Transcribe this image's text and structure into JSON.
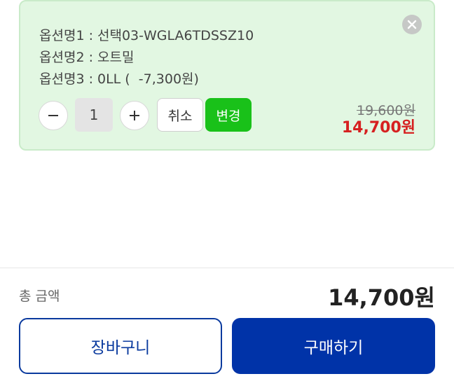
{
  "option_card": {
    "lines": [
      "옵션명1 : 선택03-WGLA6TDSSZ10",
      "옵션명2 : 오트밀",
      "옵션명3 : 0LL (  -7,300원)"
    ],
    "quantity": "1",
    "cancel_label": "취소",
    "change_label": "변경",
    "original_price": "19,600원",
    "sale_price": "14,700원",
    "icons": {
      "close": "close-icon",
      "minus": "minus-icon",
      "plus": "plus-icon"
    },
    "colors": {
      "card_bg": "#e2f7e2",
      "change_button": "#19c119",
      "sale_price": "#d62020"
    }
  },
  "summary": {
    "total_label": "총 금액",
    "total_amount": "14,700원"
  },
  "actions": {
    "cart_label": "장바구니",
    "buy_label": "구매하기",
    "colors": {
      "primary": "#0033a8"
    }
  }
}
